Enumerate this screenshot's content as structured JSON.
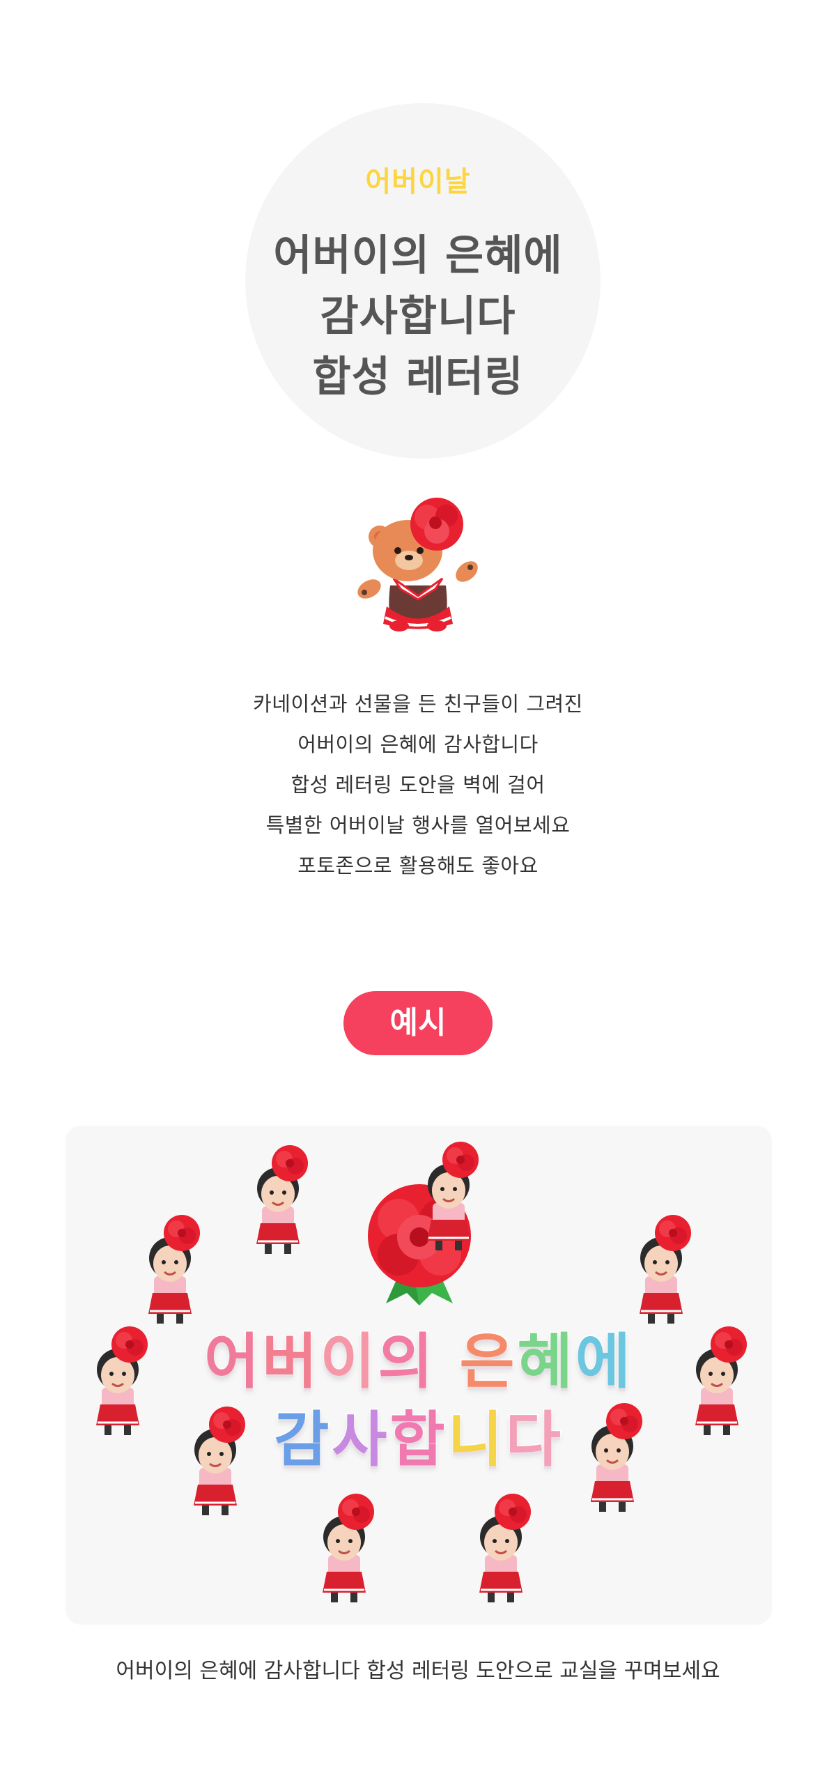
{
  "hero": {
    "subtitle": "어버이날",
    "title_lines": [
      "어버이의 은혜에",
      "감사합니다",
      "합성 레터링"
    ]
  },
  "description": {
    "lines": [
      "카네이션과 선물을 든 친구들이 그려진",
      "어버이의 은혜에 감사합니다",
      "합성 레터링 도안을 벽에 걸어",
      "특별한 어버이날 행사를 열어보세요",
      "포토존으로 활용해도 좋아요"
    ]
  },
  "example": {
    "label": "예시",
    "lettering": {
      "line1": [
        {
          "ch": "어",
          "color": "#f07a9a"
        },
        {
          "ch": "버",
          "color": "#f27e8f"
        },
        {
          "ch": "이",
          "color": "#f597a6"
        },
        {
          "ch": "의",
          "color": "#f27aa3"
        },
        {
          "ch": " ",
          "color": "#ffffff"
        },
        {
          "ch": "은",
          "color": "#f58a6a"
        },
        {
          "ch": "혜",
          "color": "#7ad48a"
        },
        {
          "ch": "에",
          "color": "#6bc6e0"
        }
      ],
      "line2": [
        {
          "ch": "감",
          "color": "#6a9ee6"
        },
        {
          "ch": "사",
          "color": "#c88ae0"
        },
        {
          "ch": "합",
          "color": "#f07ab0"
        },
        {
          "ch": "니",
          "color": "#f5d44a"
        },
        {
          "ch": "다",
          "color": "#f4a0b8"
        }
      ]
    },
    "caption": "어버이의 은혜에 감사합니다 합성 레터링 도안으로 교실을 꾸며보세요"
  },
  "colors": {
    "accent_yellow": "#fcd53f",
    "accent_pink": "#f5405e",
    "title_gray": "#555555",
    "carnation_red": "#e8202f"
  }
}
